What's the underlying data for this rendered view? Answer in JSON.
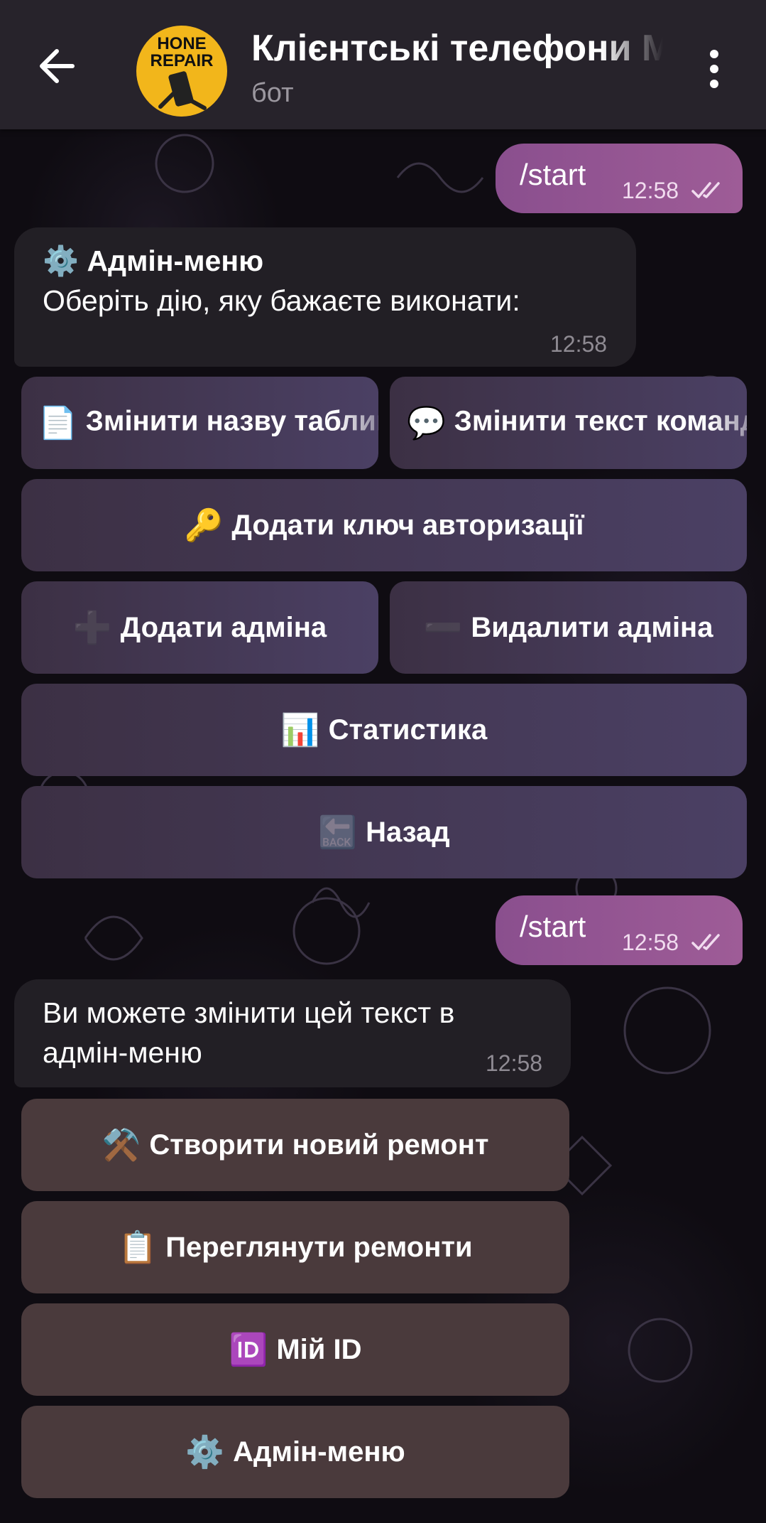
{
  "header": {
    "title": "Клієнтські телефони М",
    "subtitle": "бот",
    "avatar_text_top": "HONE",
    "avatar_text_bottom": "REPAIR"
  },
  "messages": {
    "out1": {
      "text": "/start",
      "time": "12:58"
    },
    "admin_menu": {
      "line1": "⚙️ Адмін-меню",
      "line2": "Оберіть дію, яку бажаєте виконати:",
      "time": "12:58"
    },
    "out2": {
      "text": "/start",
      "time": "12:58"
    },
    "main": {
      "line1": "Ви можете змінити цей текст в",
      "line2": "адмін-меню",
      "time": "12:58"
    }
  },
  "admin_keyboard": {
    "rename_table": {
      "icon": "📄",
      "label": "Змінити назву таблиці"
    },
    "change_text": {
      "icon": "💬",
      "label": "Змінити текст команди"
    },
    "add_key": {
      "icon": "🔑",
      "label": "Додати ключ авторизації"
    },
    "add_admin": {
      "icon": "➕",
      "label": "Додати адміна"
    },
    "remove_admin": {
      "icon": "➖",
      "label": "Видалити адміна"
    },
    "stats": {
      "icon": "📊",
      "label": "Статистика"
    },
    "back": {
      "icon": "🔙",
      "label": "Назад"
    }
  },
  "main_keyboard": {
    "new_repair": {
      "icon": "⚒️",
      "label": "Створити новий ремонт"
    },
    "view_repairs": {
      "icon": "📋",
      "label": "Переглянути ремонти"
    },
    "my_id": {
      "icon": "🆔",
      "label": "Мій ID"
    },
    "admin_menu": {
      "icon": "⚙️",
      "label": "Адмін-меню"
    }
  },
  "colors": {
    "outgoing_bubble": "#9e5c97",
    "incoming_bubble": "#221f25",
    "admin_button": "#4b4064",
    "main_button": "#4a3a3c",
    "header": "#27232b"
  }
}
